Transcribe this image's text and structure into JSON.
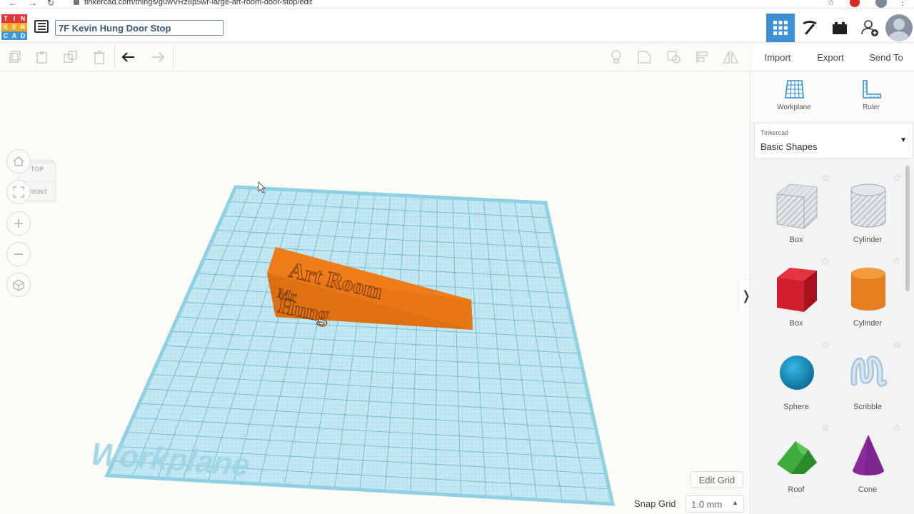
{
  "browser": {
    "url": "tinkercad.com/things/guwVRz8p5wr-large-art-room-door-stop/edit"
  },
  "header": {
    "logo_letters": [
      "T",
      "I",
      "N",
      "K",
      "E",
      "R",
      "C",
      "A",
      "D"
    ],
    "design_title": "7F Kevin Hung Door Stop"
  },
  "toolbar": {
    "import_label": "Import",
    "export_label": "Export",
    "send_to_label": "Send To"
  },
  "viewcube": {
    "top_label": "TOP",
    "front_label": "FRONT"
  },
  "workplane": {
    "watermark": "Workplane",
    "edit_grid_label": "Edit Grid",
    "snap_grid_label": "Snap Grid",
    "snap_grid_value": "1.0 mm"
  },
  "model": {
    "text_line_1": "Art Room",
    "text_line_2": "Mr",
    "text_line_3": "Hung",
    "color": "#ef7d1a"
  },
  "panel": {
    "workplane_label": "Workplane",
    "ruler_label": "Ruler",
    "library_category": "Tinkercad",
    "library_name": "Basic Shapes",
    "shapes": [
      {
        "name": "Box"
      },
      {
        "name": "Cylinder"
      },
      {
        "name": "Box"
      },
      {
        "name": "Cylinder"
      },
      {
        "name": "Sphere"
      },
      {
        "name": "Scribble"
      },
      {
        "name": "Roof"
      },
      {
        "name": "Cone"
      }
    ]
  },
  "colors": {
    "accent": "#3d8fd6",
    "grid": "#9fd8e8",
    "red_box": "#d0202f",
    "orange_cylinder": "#e57e1f",
    "sphere": "#1495c7",
    "roof": "#3eab3a",
    "cone": "#8a2a9d"
  }
}
